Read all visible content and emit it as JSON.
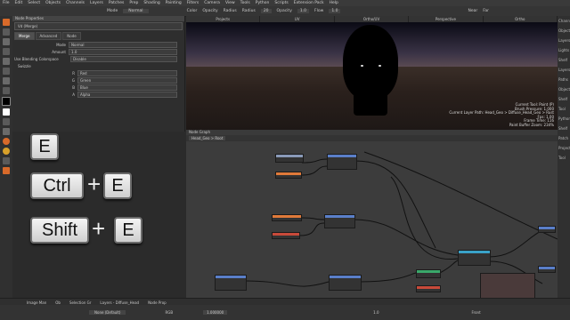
{
  "menu": [
    "File",
    "Edit",
    "Select",
    "Objects",
    "Channels",
    "Layers",
    "Patches",
    "Prep",
    "Shading",
    "Painting",
    "Filters",
    "Camera",
    "View",
    "Tools",
    "Python",
    "Scripts",
    "Extension Pack",
    "Help"
  ],
  "toolbar": {
    "mode_label": "Mode",
    "mode_value": "Normal",
    "color_label": "Color",
    "opacity_label": "Opacity",
    "radius_label": "Radius",
    "radius_value": "20",
    "opacity2_label": "Opacity",
    "opacity2_value": "1.0",
    "flow_label": "Flow",
    "flow_value": "1.0",
    "near_label": "Near",
    "far_label": "Far"
  },
  "props": {
    "title": "Node Properties",
    "node_name": "Vd (Merge)",
    "tabs": [
      "Merge",
      "Advanced",
      "Node"
    ],
    "mode_label": "Mode",
    "mode_value": "Normal",
    "amount_label": "Amount",
    "amount_value": "1.0",
    "colorspace_label": "Use Blending Colorspace",
    "colorspace_value": "Disable",
    "swizzle_label": "Swizzle",
    "channels": [
      {
        "label": "R",
        "value": "Red"
      },
      {
        "label": "G",
        "value": "Green"
      },
      {
        "label": "B",
        "value": "Blue"
      },
      {
        "label": "A",
        "value": "Alpha"
      }
    ]
  },
  "shortcuts": {
    "key_e": "E",
    "key_ctrl": "Ctrl",
    "key_e2": "E",
    "key_shift": "Shift",
    "key_e3": "E",
    "plus": "+"
  },
  "viewport": {
    "tabs": [
      "Projects",
      "UV",
      "Ortho/UV",
      "Perspective",
      "Ortho"
    ],
    "hud": [
      "Current Tool: Paint (P)",
      "Brush Pressure: 1.000",
      "Current Layer Path: Head_Geo > Diffuse_Head_Geo > Rust",
      "Fps: 1.00",
      "Frame Time: 116",
      "Paint Buffer Zoom: 234%"
    ]
  },
  "node_graph": {
    "title": "Node Graph",
    "crumb": "Head_Geo > Root"
  },
  "bottom_tabs": [
    "Image Man",
    "Ob",
    "Selection Gr",
    "Layers - Diffuse_Head",
    "Node Prop"
  ],
  "status": {
    "blend_label": "None (Default)",
    "format": "RGB",
    "zoom": "1.000000",
    "value": "1.0",
    "right": "Front"
  },
  "right_panel": [
    "Channels",
    "Objects",
    "Layers",
    "Lights",
    "Shelf",
    "Layers",
    "Paths",
    "Objects",
    "Shelf",
    "Tool",
    "Python",
    "Shelf",
    "Patch",
    "Projection",
    "Tool"
  ],
  "colors": {
    "node_blue": "#5a7fc9",
    "node_orange": "#e07a3a",
    "node_red": "#c84a3a",
    "node_green": "#3aa86a",
    "node_cyan": "#3aa2c8"
  }
}
